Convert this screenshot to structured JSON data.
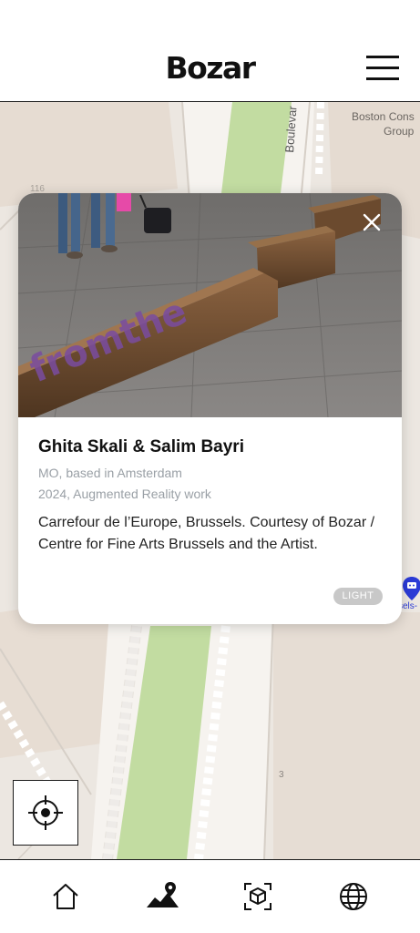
{
  "app": {
    "title": "Bozar"
  },
  "header": {
    "menu_icon": "hamburger-menu-icon"
  },
  "map": {
    "labels": {
      "boulevard": "Boulevar",
      "boston_line1": "Boston Cons",
      "boston_line2": "Group",
      "number_116": "116",
      "number_3": "3",
      "poi_label": "sels-"
    },
    "locate_icon": "crosshair-locate-icon",
    "poi_icon": "map-poi-icon"
  },
  "artwork": {
    "artist": "Ghita Skali & Salim Bayri",
    "origin": "MO, based in Amsterdam",
    "year_medium": "2024, Augmented Reality work",
    "description": "Carrefour de l’Europe, Brussels. Courtesy of Bozar / Centre for Fine Arts Brussels and the Artist.",
    "badge": "LIGHT",
    "bench_text": "fromthe",
    "close_icon": "close-icon"
  },
  "nav": {
    "items": [
      {
        "name": "home",
        "icon": "home-icon"
      },
      {
        "name": "map",
        "icon": "map-icon",
        "active": true
      },
      {
        "name": "ar",
        "icon": "ar-cube-icon"
      },
      {
        "name": "language",
        "icon": "globe-icon"
      }
    ]
  },
  "colors": {
    "map_base": "#ece7e1",
    "map_park": "#c2dca1",
    "badge_bg": "#c8c8c8",
    "poi_blue": "#2b3bd6"
  }
}
